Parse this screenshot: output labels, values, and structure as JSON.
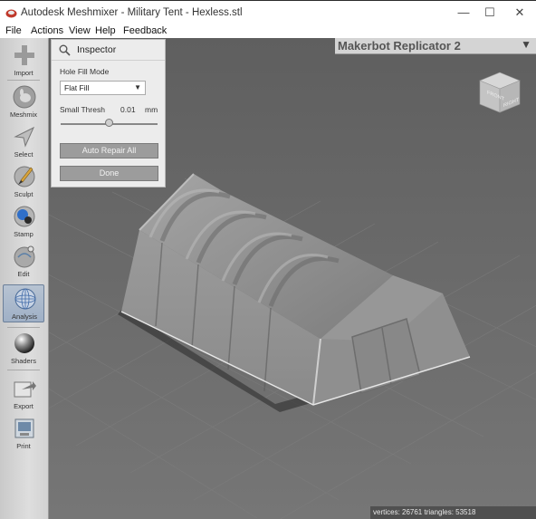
{
  "window": {
    "title": "Autodesk Meshmixer - Military Tent - Hexless.stl",
    "controls": {
      "minimize": "—",
      "maximize": "☐",
      "close": "✕"
    }
  },
  "menu": [
    "File",
    "Actions",
    "View",
    "Help",
    "Feedback"
  ],
  "toolbar": {
    "tools": [
      {
        "label": "Import",
        "icon": "plus-icon"
      },
      {
        "label": "Meshmix",
        "icon": "bunny-sphere-icon"
      },
      {
        "label": "Select",
        "icon": "arrow-cursor-icon"
      },
      {
        "label": "Sculpt",
        "icon": "brush-icon"
      },
      {
        "label": "Stamp",
        "icon": "stamp-icon"
      },
      {
        "label": "Edit",
        "icon": "edit-sphere-icon"
      },
      {
        "label": "Analysis",
        "icon": "analysis-sphere-icon",
        "active": true
      },
      {
        "label": "Shaders",
        "icon": "shader-sphere-icon"
      },
      {
        "label": "Export",
        "icon": "export-icon"
      },
      {
        "label": "Print",
        "icon": "print-icon"
      }
    ]
  },
  "inspector": {
    "title": "Inspector",
    "hole_fill_mode_label": "Hole Fill Mode",
    "hole_fill_mode_value": "Flat Fill",
    "small_thresh_label": "Small Thresh",
    "small_thresh_value": "0.01",
    "small_thresh_unit": "mm",
    "slider_fraction": 0.5,
    "auto_repair_label": "Auto Repair All",
    "done_label": "Done"
  },
  "printer": {
    "name": "Makerbot Replicator 2"
  },
  "navcube": {
    "left_face": "FRONT",
    "right_face": "RIGHT"
  },
  "status": {
    "text": "vertices: 26761 triangles: 53518"
  },
  "colors": {
    "viewport_bg": "#6f6f6f",
    "model": "#8d8d8d",
    "active_tool": "#9fb0c6"
  }
}
